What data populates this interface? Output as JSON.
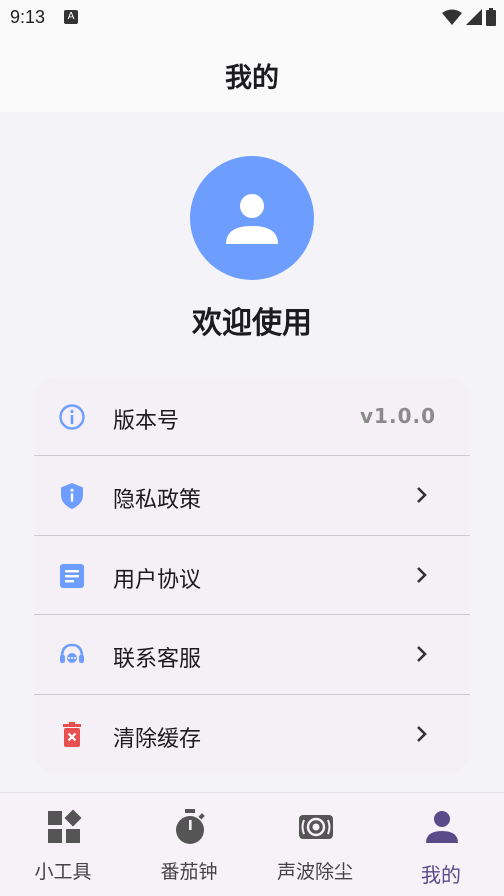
{
  "status_bar": {
    "time": "9:13",
    "notification_letter": "A"
  },
  "header": {
    "title": "我的"
  },
  "profile": {
    "welcome": "欢迎使用"
  },
  "menu": {
    "items": [
      {
        "label": "版本号",
        "value": "v1.0.0",
        "icon": "info-icon"
      },
      {
        "label": "隐私政策",
        "icon": "privacy-shield-icon"
      },
      {
        "label": "用户协议",
        "icon": "document-icon"
      },
      {
        "label": "联系客服",
        "icon": "headset-icon"
      },
      {
        "label": "清除缓存",
        "icon": "trash-icon"
      }
    ]
  },
  "bottom_nav": {
    "items": [
      {
        "label": "小工具",
        "icon": "widgets-icon"
      },
      {
        "label": "番茄钟",
        "icon": "timer-icon"
      },
      {
        "label": "声波除尘",
        "icon": "speaker-icon"
      },
      {
        "label": "我的",
        "icon": "person-icon",
        "active": true
      }
    ]
  },
  "colors": {
    "accent": "#6d9eff",
    "active_nav": "#5a4a8a",
    "card_bg": "#f5eff6",
    "trash_red": "#e85050"
  }
}
